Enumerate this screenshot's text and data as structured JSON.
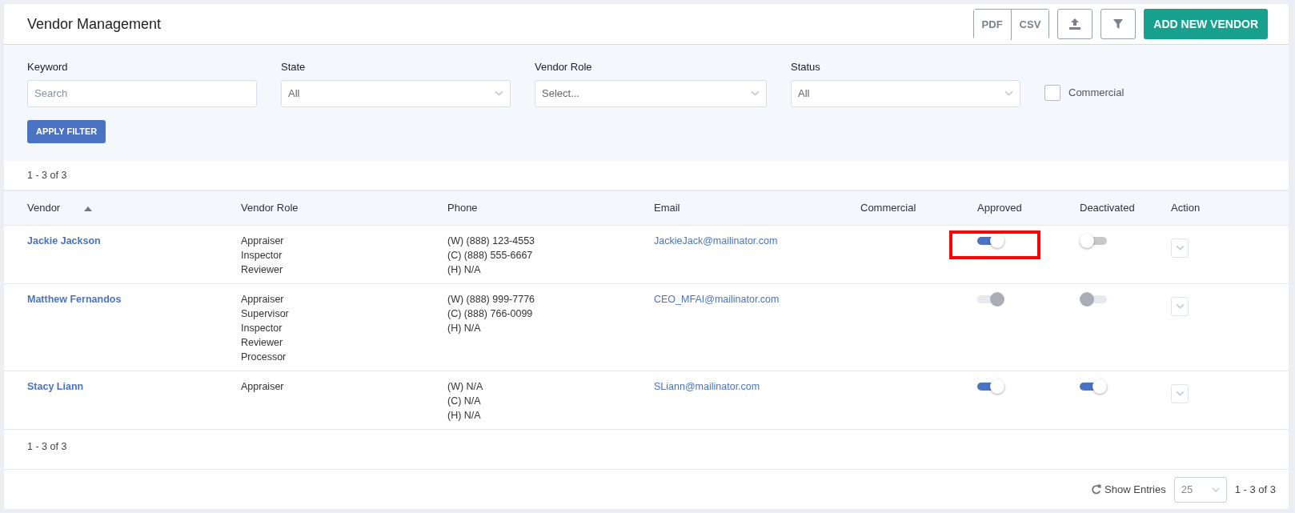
{
  "header": {
    "title": "Vendor Management",
    "export_buttons": [
      "PDF",
      "CSV"
    ],
    "add_button": "ADD NEW VENDOR"
  },
  "filters": {
    "fields": [
      {
        "label": "Keyword",
        "kind": "text",
        "placeholder": "Search"
      },
      {
        "label": "State",
        "kind": "select",
        "value": "All"
      },
      {
        "label": "Vendor Role",
        "kind": "select",
        "value": "Select..."
      },
      {
        "label": "Status",
        "kind": "select",
        "value": "All"
      }
    ],
    "checkbox": {
      "label": "Commercial",
      "checked": false
    },
    "apply_button": "APPLY FILTER"
  },
  "top_count": "1 - 3 of 3",
  "table": {
    "columns": [
      "Vendor",
      "Vendor Role",
      "Phone",
      "Email",
      "Commercial",
      "Approved",
      "Deactivated",
      "Action"
    ],
    "rows": [
      {
        "vendor": "Jackie Jackson",
        "roles": [
          "Appraiser",
          "Inspector",
          "Reviewer"
        ],
        "phones": [
          "(W) (888) 123-4553",
          "(C) (888) 555-6667",
          "(H) N/A"
        ],
        "email": "JackieJack@mailinator.com",
        "approved": {
          "on": true,
          "disabled": false,
          "highlighted": true
        },
        "deactivated": {
          "on": false,
          "disabled": false,
          "highlighted": false
        }
      },
      {
        "vendor": "Matthew Fernandos",
        "roles": [
          "Appraiser",
          "Supervisor",
          "Inspector",
          "Reviewer",
          "Processor"
        ],
        "phones": [
          "(W) (888) 999-7776",
          "(C) (888) 766-0099",
          "(H) N/A"
        ],
        "email": "CEO_MFAI@mailinator.com",
        "approved": {
          "on": true,
          "disabled": true,
          "highlighted": false
        },
        "deactivated": {
          "on": false,
          "disabled": true,
          "highlighted": false
        }
      },
      {
        "vendor": "Stacy Liann",
        "roles": [
          "Appraiser"
        ],
        "phones": [
          "(W) N/A",
          "(C) N/A",
          "(H) N/A"
        ],
        "email": "SLiann@mailinator.com",
        "approved": {
          "on": true,
          "disabled": false,
          "highlighted": false
        },
        "deactivated": {
          "on": true,
          "disabled": false,
          "highlighted": false
        }
      }
    ]
  },
  "bottom_count": "1 - 3 of 3",
  "footer": {
    "show_entries": "Show Entries",
    "page_size": "25",
    "range": "1 - 3 of 3"
  }
}
